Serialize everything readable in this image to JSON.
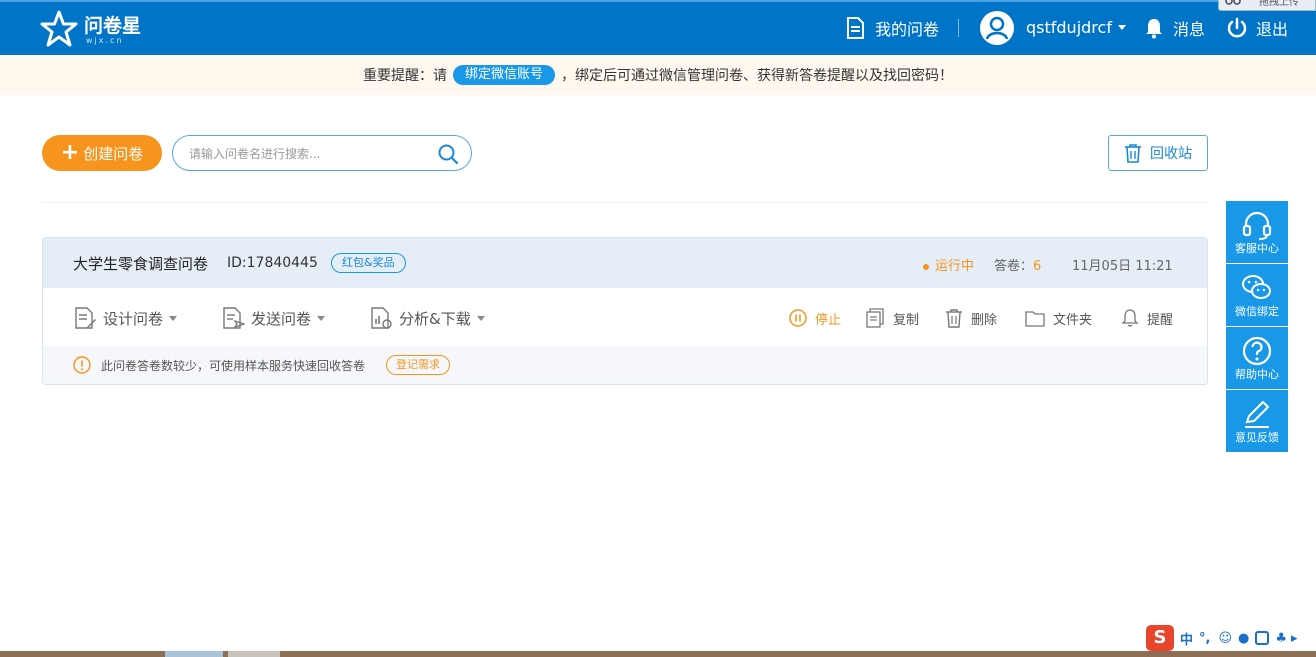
{
  "header": {
    "logo_text": "问卷星",
    "logo_sub": "wjx.cn",
    "my_surveys": "我的问卷",
    "username": "qstfdujdrcf",
    "messages": "消息",
    "logout": "退出",
    "corner_tab": "拖拽上传"
  },
  "notice": {
    "prefix": "重要提醒：请",
    "link": "绑定微信账号",
    "suffix": "，绑定后可通过微信管理问卷、获得新答卷提醒以及找回密码！"
  },
  "toolbar": {
    "create_label": "创建问卷",
    "search_placeholder": "请输入问卷名进行搜索...",
    "recycle_label": "回收站"
  },
  "survey": {
    "title": "大学生零食调查问卷",
    "id_label": "ID:17840445",
    "tag": "红包&奖品",
    "status": "运行中",
    "answers_label": "答卷：",
    "answers_count": "6",
    "date": "11月05日 11:21",
    "actions": {
      "design": "设计问卷",
      "send": "发送问卷",
      "analyze": "分析&下载",
      "stop": "停止",
      "copy": "复制",
      "delete": "删除",
      "folder": "文件夹",
      "remind": "提醒"
    },
    "footer_text": "此问卷答卷数较少，可使用样本服务快速回收答卷",
    "footer_button": "登记需求"
  },
  "sidebar": {
    "items": [
      {
        "label": "客服中心",
        "icon": "headset-icon"
      },
      {
        "label": "微信绑定",
        "icon": "wechat-icon"
      },
      {
        "label": "帮助中心",
        "icon": "help-icon"
      },
      {
        "label": "意见反馈",
        "icon": "pencil-icon"
      }
    ]
  },
  "ime": {
    "logo": "S",
    "mode": "中"
  },
  "colors": {
    "brand_blue": "#0075c8",
    "accent_orange": "#f7941d",
    "link_blue": "#1a98e8"
  }
}
